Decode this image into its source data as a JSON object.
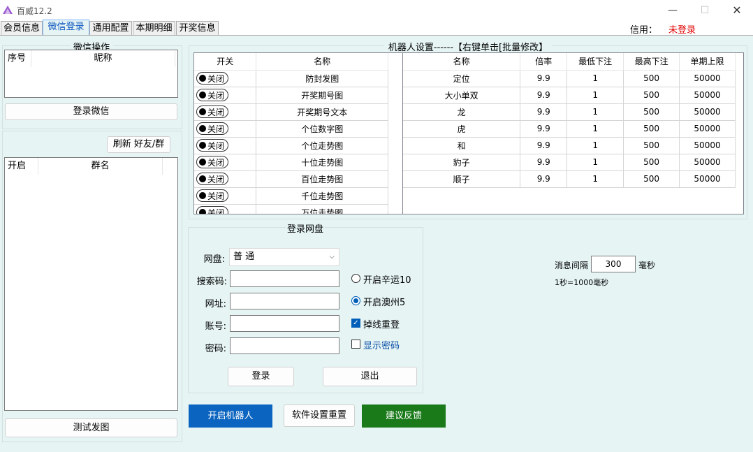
{
  "window": {
    "title": "百威12.2"
  },
  "tabs": [
    "会员信息",
    "微信登录",
    "通用配置",
    "本期明细",
    "开奖信息"
  ],
  "credit": {
    "label": "信用：",
    "value": "未登录",
    "value_color": "#e00000"
  },
  "wechat": {
    "group_title": "微信操作",
    "columns": [
      "序号",
      "昵称"
    ],
    "login_button": "登录微信",
    "refresh_button": "刷新 好友/群",
    "group_columns": [
      "开启",
      "群名"
    ],
    "test_button": "测试发图"
  },
  "robot": {
    "group_title": "机器人设置------【右键单击[批量修改】",
    "switch_columns": [
      "开关",
      "名称"
    ],
    "switch_rows": [
      {
        "state": "关闭",
        "name": "防封发图"
      },
      {
        "state": "关闭",
        "name": "开奖期号图"
      },
      {
        "state": "关闭",
        "name": "开奖期号文本"
      },
      {
        "state": "关闭",
        "name": "个位数字图"
      },
      {
        "state": "关闭",
        "name": "个位走势图"
      },
      {
        "state": "关闭",
        "name": "十位走势图"
      },
      {
        "state": "关闭",
        "name": "百位走势图"
      },
      {
        "state": "关闭",
        "name": "千位走势图"
      },
      {
        "state": "关闭",
        "name": "万位走势图"
      }
    ],
    "rate_columns": [
      "名称",
      "倍率",
      "最低下注",
      "最高下注",
      "单期上限"
    ],
    "rate_rows": [
      [
        "定位",
        "9.9",
        "1",
        "500",
        "50000"
      ],
      [
        "大小单双",
        "9.9",
        "1",
        "500",
        "50000"
      ],
      [
        "龙",
        "9.9",
        "1",
        "500",
        "50000"
      ],
      [
        "虎",
        "9.9",
        "1",
        "500",
        "50000"
      ],
      [
        "和",
        "9.9",
        "1",
        "500",
        "50000"
      ],
      [
        "豹子",
        "9.9",
        "1",
        "500",
        "50000"
      ],
      [
        "顺子",
        "9.9",
        "1",
        "500",
        "50000"
      ]
    ]
  },
  "netdisk": {
    "group_title": "登录网盘",
    "disk_label": "网盘:",
    "disk_value": "普 通",
    "search_label": "搜索码:",
    "url_label": "网址:",
    "account_label": "账号:",
    "password_label": "密码:",
    "option_lucky10": "开启辛运10",
    "option_macau5": "开启澳州5",
    "option_relogin": "掉线重登",
    "option_show_password": "显示密码",
    "login_button": "登录",
    "logout_button": "退出"
  },
  "interval": {
    "label": "消息间隔",
    "value": "300",
    "unit": "毫秒",
    "note": "1秒=1000毫秒"
  },
  "actions": {
    "start_robot": "开启机器人",
    "reset_settings": "软件设置重置",
    "feedback": "建议反馈"
  }
}
